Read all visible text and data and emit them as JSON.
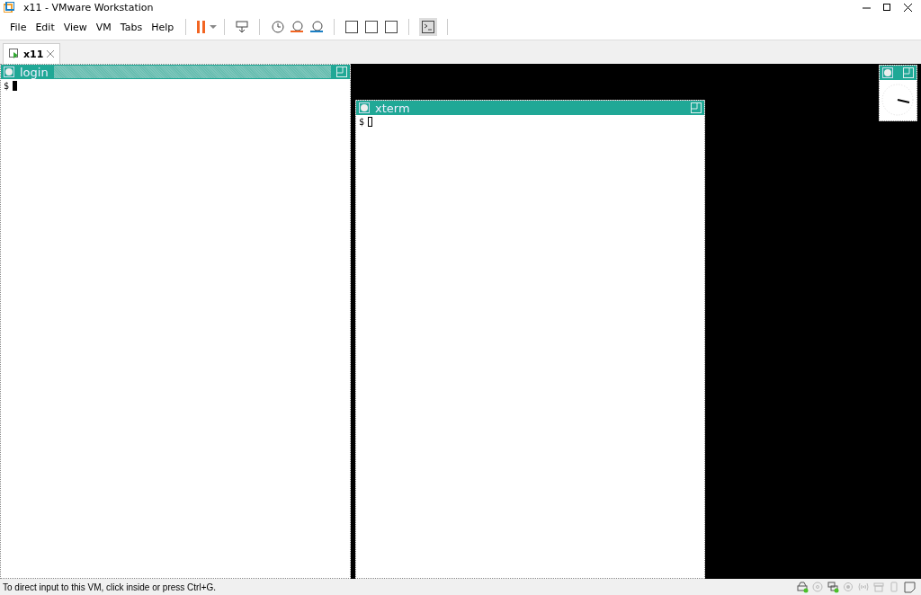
{
  "window": {
    "title": "x11 - VMware Workstation"
  },
  "menu": [
    "File",
    "Edit",
    "View",
    "VM",
    "Tabs",
    "Help"
  ],
  "tabs": [
    {
      "label": "x11",
      "selected": true
    }
  ],
  "desktop": {
    "windows": [
      {
        "kind": "terminal",
        "title": "login",
        "prompt": "$",
        "focused": true
      },
      {
        "kind": "terminal",
        "title": "xterm",
        "prompt": "$",
        "focused": false
      },
      {
        "kind": "clock",
        "focused": false
      }
    ]
  },
  "status_bar": {
    "message": "To direct input to this VM, click inside or press Ctrl+G.",
    "devices": [
      {
        "kind": "disk",
        "connected": true
      },
      {
        "kind": "cd",
        "connected": false
      },
      {
        "kind": "network",
        "connected": true
      },
      {
        "kind": "sound",
        "connected": false
      },
      {
        "kind": "wireless",
        "connected": false
      },
      {
        "kind": "printer",
        "connected": false
      },
      {
        "kind": "usb",
        "connected": false
      }
    ]
  }
}
